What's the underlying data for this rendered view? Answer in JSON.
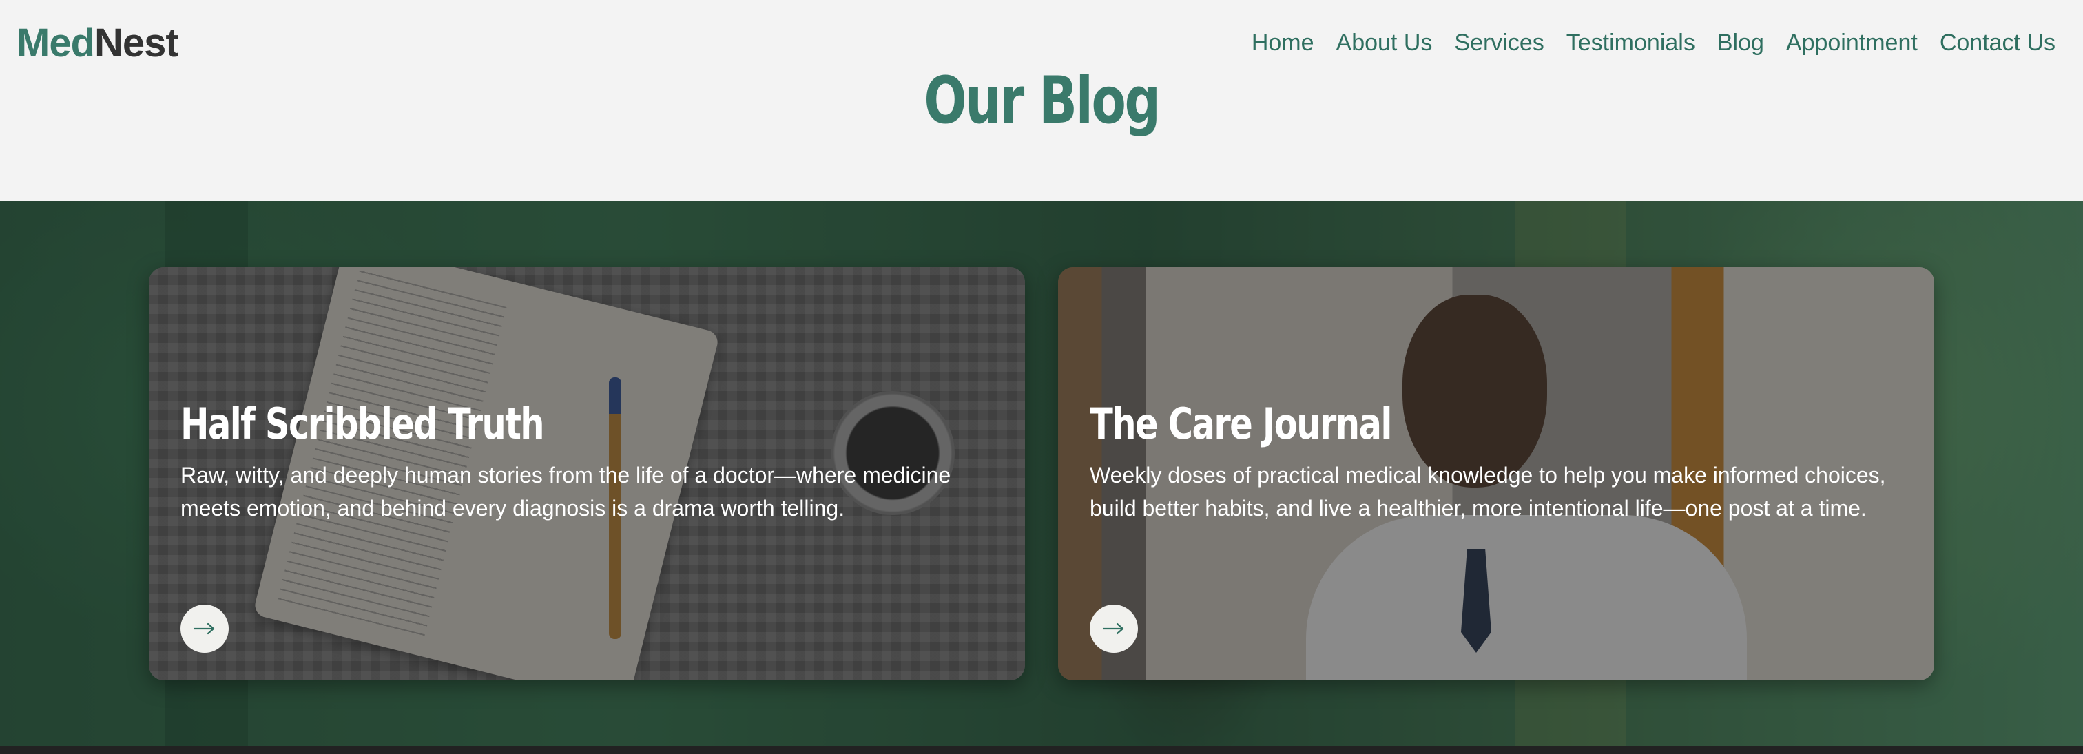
{
  "header": {
    "logo_part1": "Med",
    "logo_part2": "Nest",
    "nav": [
      "Home",
      "About Us",
      "Services",
      "Testimonials",
      "Blog",
      "Appointment",
      "Contact Us"
    ]
  },
  "page_title": "Our Blog",
  "cards": [
    {
      "title": "Half Scribbled Truth",
      "text": "Raw, witty, and deeply human stories from the life of a doctor—where medicine meets emotion, and behind every diagnosis is a drama worth telling.",
      "icon": "arrow-right-icon"
    },
    {
      "title": "The Care Journal",
      "text": "Weekly doses of practical medical knowledge to help you make informed choices, build better habits, and live a healthier, more intentional life—one post at a time.",
      "icon": "arrow-right-icon"
    }
  ],
  "colors": {
    "brand_green": "#3a7a6b",
    "brand_dark": "#333333",
    "nav_text": "#2f6f60",
    "background": "#f3f3f3"
  }
}
